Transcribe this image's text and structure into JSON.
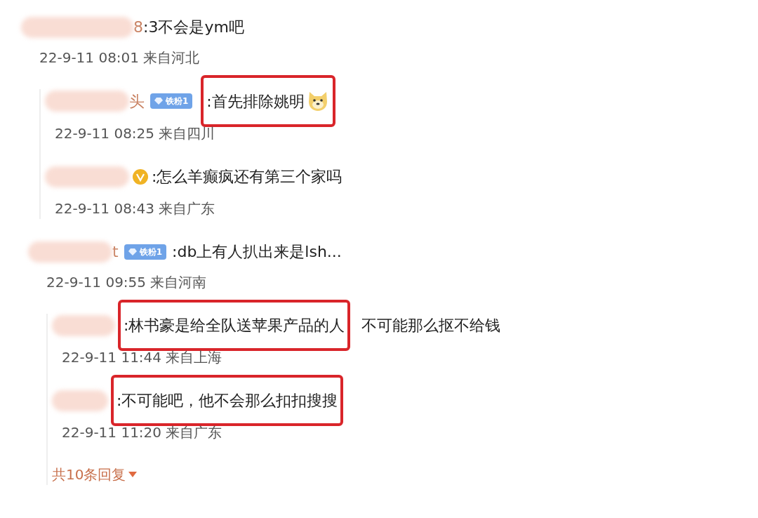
{
  "threads": [
    {
      "name_tail": "8",
      "text": ":3不会是ym吧",
      "time": "22-9-11 08:01 来自河北",
      "replies": [
        {
          "name_tail": "头",
          "badge": {
            "kind": "fan",
            "label": "铁粉1"
          },
          "text": ":首先排除姚明",
          "emoji": true,
          "highlighted": true,
          "time": "22-9-11 08:25 来自四川"
        },
        {
          "badge": {
            "kind": "verified"
          },
          "text": ":怎么羊癫疯还有第三个家吗",
          "emoji": false,
          "highlighted": false,
          "time": "22-9-11 08:43 来自广东"
        }
      ]
    },
    {
      "name_tail": "t",
      "badge": {
        "kind": "fan",
        "label": "铁粉1"
      },
      "text": ":db上有人扒出来是lsh...",
      "time": "22-9-11 09:55 来自河南",
      "replies": [
        {
          "text": ":林书豪是给全队送苹果产品的人",
          "after": "不可能那么抠不给钱",
          "emoji": false,
          "highlighted": true,
          "time": "22-9-11 11:44 来自上海"
        },
        {
          "text": ":不可能吧，他不会那么扣扣搜搜",
          "emoji": false,
          "highlighted": true,
          "time": "22-9-11 11:20 来自广东"
        }
      ],
      "more": "共10条回复"
    }
  ]
}
